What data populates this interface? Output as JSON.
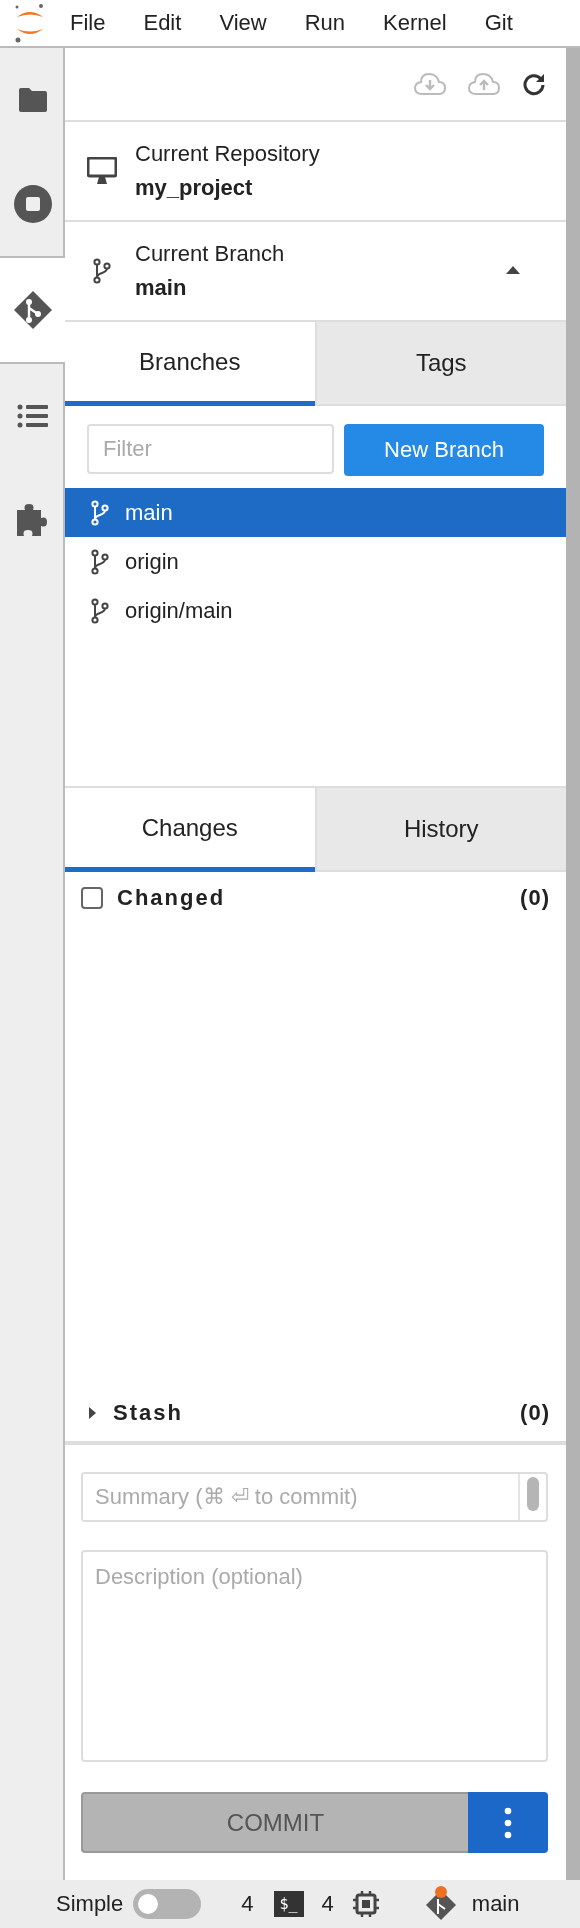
{
  "menu_bar": {
    "items": [
      "File",
      "Edit",
      "View",
      "Run",
      "Kernel",
      "Git"
    ]
  },
  "left_sidebar": {
    "tabs": [
      {
        "kind": "folder",
        "selected": false
      },
      {
        "kind": "running",
        "selected": false
      },
      {
        "kind": "git",
        "selected": true
      },
      {
        "kind": "toc",
        "selected": false
      },
      {
        "kind": "extensions",
        "selected": false
      }
    ]
  },
  "current_repository": {
    "label": "Current Repository",
    "value": "my_project"
  },
  "current_branch": {
    "label": "Current Branch",
    "value": "main"
  },
  "branch_tabs": [
    {
      "label": "Branches",
      "selected": true
    },
    {
      "label": "Tags",
      "selected": false
    }
  ],
  "filter": {
    "placeholder": "Filter"
  },
  "new_branch_button": "New Branch",
  "branches": [
    {
      "name": "main",
      "selected": true
    },
    {
      "name": "origin",
      "selected": false
    },
    {
      "name": "origin/main",
      "selected": false
    }
  ],
  "change_tabs": [
    {
      "label": "Changes",
      "selected": true
    },
    {
      "label": "History",
      "selected": false
    }
  ],
  "changed_section": {
    "title": "Changed",
    "count": "(0)",
    "checked": false
  },
  "stash_section": {
    "title": "Stash",
    "count": "(0)",
    "expanded": false
  },
  "summary": {
    "placeholder": "Summary (⌘ ⏎ to commit)"
  },
  "description": {
    "placeholder": "Description (optional)"
  },
  "commit_button": {
    "label": "COMMIT",
    "disabled": true
  },
  "status_bar": {
    "mode_label": "Simple",
    "simple_mode": false,
    "terminals": "4",
    "terminal_glyph": "$_",
    "kernels": "4",
    "branch": "main"
  }
}
